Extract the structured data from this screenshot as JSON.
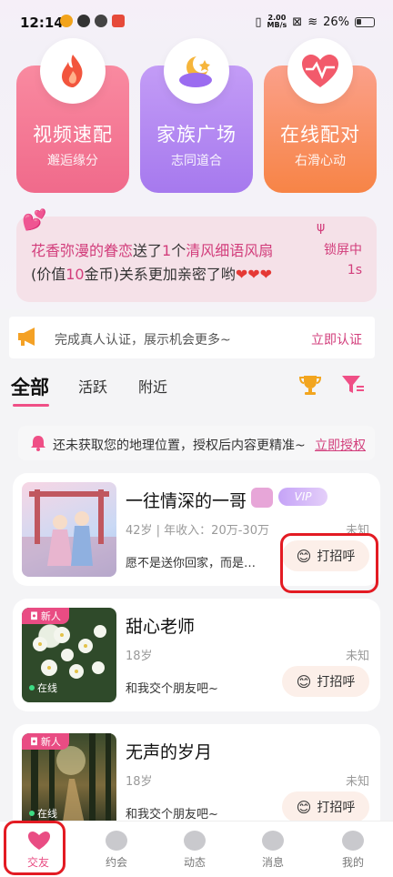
{
  "status_bar": {
    "time": "12:14",
    "net_speed_value": "2.00",
    "net_speed_unit": "MB/s",
    "battery": "26%"
  },
  "features": [
    {
      "title": "视频速配",
      "subtitle": "邂逅缘分",
      "icon": "fire-icon"
    },
    {
      "title": "家族广场",
      "subtitle": "志同道合",
      "icon": "moon-cloud-icon"
    },
    {
      "title": "在线配对",
      "subtitle": "右滑心动",
      "icon": "heartbeat-icon"
    }
  ],
  "notice": {
    "sender": "花香弥漫的眷恋",
    "sent": "送了",
    "count": "1",
    "unit": "个",
    "gift": "清风细语风扇",
    "value_prefix": "(价值",
    "value": "10",
    "value_suffix": "金币)关系更加亲密了哟",
    "lock_label": "锁屏中",
    "lock_time": "1s"
  },
  "verify": {
    "text": "完成真人认证，展示机会更多~",
    "action": "立即认证"
  },
  "tabs": [
    "全部",
    "活跃",
    "附近"
  ],
  "location": {
    "text": "还未获取您的地理位置，授权后内容更精准~",
    "action": "立即授权"
  },
  "users": [
    {
      "name": "一往情深的一哥",
      "meta": "42岁 | 年收入：20万-30万",
      "right": "未知",
      "intro": "愿不是送你回家，而是…",
      "greet": "打招呼",
      "vip": "VIP"
    },
    {
      "name": "甜心老师",
      "meta": "18岁",
      "right": "未知",
      "intro": "和我交个朋友吧~",
      "greet": "打招呼",
      "badge": "新人",
      "online": "在线"
    },
    {
      "name": "无声的岁月",
      "meta": "18岁",
      "right": "未知",
      "intro": "和我交个朋友吧~",
      "greet": "打招呼",
      "badge": "新人",
      "online": "在线"
    }
  ],
  "nav": [
    {
      "label": "交友",
      "icon": "hearts-icon"
    },
    {
      "label": "约会",
      "icon": "heart-bubble-icon"
    },
    {
      "label": "动态",
      "icon": "compass-icon"
    },
    {
      "label": "消息",
      "icon": "chat-icon"
    },
    {
      "label": "我的",
      "icon": "person-icon"
    }
  ],
  "colors": {
    "accent": "#e94c83",
    "pink_text": "#d23d7b",
    "highlight_border": "#e31b23"
  }
}
